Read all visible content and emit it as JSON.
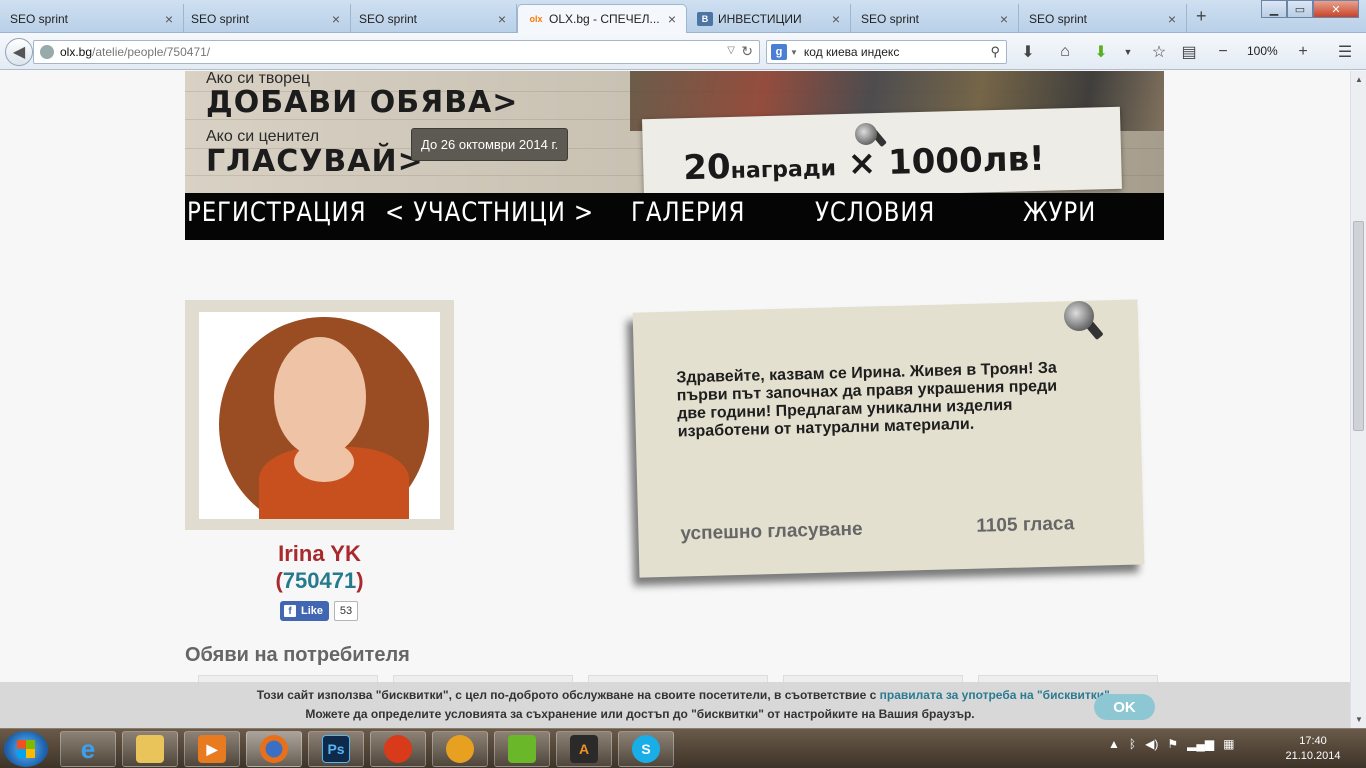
{
  "browser": {
    "tabs": [
      {
        "title": "SEO sprint",
        "close": "×"
      },
      {
        "title": "SEO sprint",
        "close": "×"
      },
      {
        "title": "SEO sprint",
        "close": "×"
      },
      {
        "title": "OLX.bg - СПЕЧЕЛ...",
        "close": "×",
        "favicon": "olx",
        "active": true
      },
      {
        "title": "ИНВЕСТИЦИИ",
        "close": "×",
        "favicon": "В"
      },
      {
        "title": "SEO sprint",
        "close": "×"
      },
      {
        "title": "SEO sprint",
        "close": "×"
      }
    ],
    "new_tab": "+",
    "url_host": "olx.bg",
    "url_path": "/atelie/people/750471/",
    "search_engine": "g",
    "search_value": "код киева индекс",
    "zoom": "100%",
    "icons": {
      "back": "back-arrow-icon",
      "download": "download-icon",
      "home": "home-icon",
      "addon": "green-arrow-icon",
      "bookmark": "star-icon",
      "reader": "clipboard-icon",
      "zoom_out": "minus-icon",
      "zoom_in": "plus-icon",
      "menu": "hamburger-icon"
    }
  },
  "banner": {
    "line1_small": "Ако си творец",
    "line1_big": "ДОБАВИ ОБЯВА>",
    "line2_small": "Ако си ценител",
    "line2_big": "ГЛАСУВАЙ>",
    "date_badge": "До 26 октомври 2014 г.",
    "prize_count": "20",
    "prize_word": "награди",
    "prize_times": "×",
    "prize_amount": "1000лв!"
  },
  "menu": {
    "items": [
      "РЕГИСТРАЦИЯ",
      "< УЧАСТНИЦИ >",
      "ГАЛЕРИЯ",
      "УСЛОВИЯ",
      "ЖУРИ"
    ]
  },
  "profile": {
    "name": "Irina YK",
    "id_open": "(",
    "id": "750471",
    "id_close": ")",
    "like_label": "Like",
    "like_count": "53"
  },
  "note": {
    "text": "Здравейте, казвам се Ирина. Живея в Троян! За първи път започнах да правя украшения преди две години! Предлагам уникални изделия изработени от натурални материали.",
    "status": "успешно гласуване",
    "votes": "1105 гласа"
  },
  "listings": {
    "title": "Обяви на потребителя"
  },
  "cookie": {
    "line1_prefix": "Този сайт използва \"бисквитки\", с цел по-доброто обслужване на своите посетители, в съответствие с ",
    "line1_link": "правилата за употреба на \"бисквитки\"",
    "line1_suffix": ".",
    "line2": "Можете да определите условията за съхранение или достъп до \"бисквитки\" от настройките на Вашия браузър.",
    "ok": "OK"
  },
  "taskbar": {
    "apps": [
      "ie-icon",
      "explorer-icon",
      "media-player-icon",
      "firefox-icon",
      "photoshop-icon",
      "app-icon",
      "webcam-icon",
      "corel-icon",
      "a-icon",
      "skype-icon"
    ],
    "ps_label": "Ps",
    "a_label": "A",
    "skype_label": "S",
    "time": "17:40",
    "date": "21.10.2014"
  }
}
